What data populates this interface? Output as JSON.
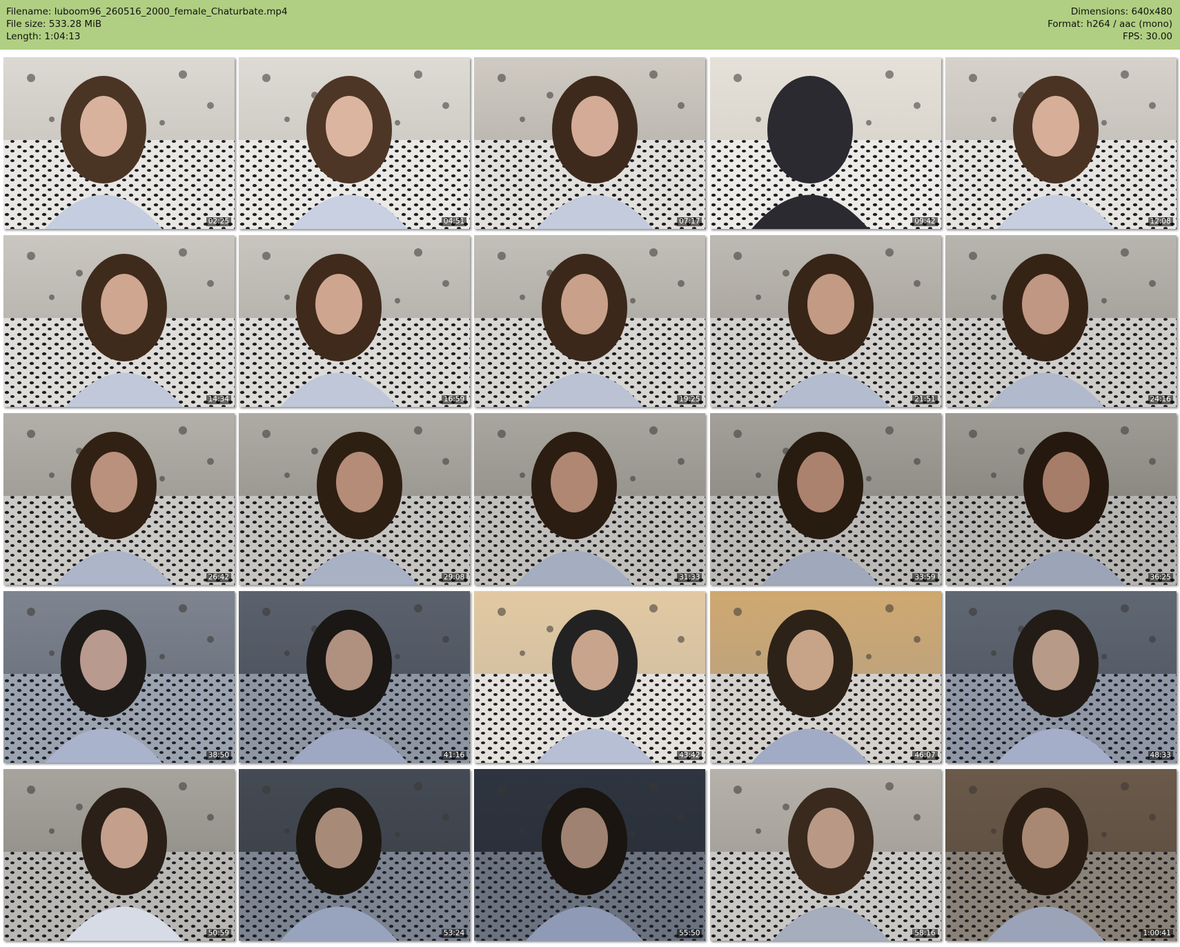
{
  "header": {
    "filename": "Filename: luboom96_260516_2000_female_Chaturbate.mp4",
    "filesize": "File size: 533.28 MiB",
    "length": "Length: 1:04:13",
    "dimensions": "Dimensions: 640x480",
    "format": "Format: h264 / aac (mono)",
    "fps": "FPS: 30.00"
  },
  "thumbnails": [
    {
      "time": "02:25"
    },
    {
      "time": "04:51"
    },
    {
      "time": "07:17"
    },
    {
      "time": "09:42"
    },
    {
      "time": "12:08"
    },
    {
      "time": "14:34"
    },
    {
      "time": "16:59"
    },
    {
      "time": "19:25"
    },
    {
      "time": "21:51"
    },
    {
      "time": "24:16"
    },
    {
      "time": "26:42"
    },
    {
      "time": "29:08"
    },
    {
      "time": "31:33"
    },
    {
      "time": "33:59"
    },
    {
      "time": "36:25"
    },
    {
      "time": "38:50"
    },
    {
      "time": "41:16"
    },
    {
      "time": "43:42"
    },
    {
      "time": "46:07"
    },
    {
      "time": "48:33"
    },
    {
      "time": "50:59"
    },
    {
      "time": "53:24"
    },
    {
      "time": "55:50"
    },
    {
      "time": "58:16"
    },
    {
      "time": "1:00:41"
    }
  ]
}
